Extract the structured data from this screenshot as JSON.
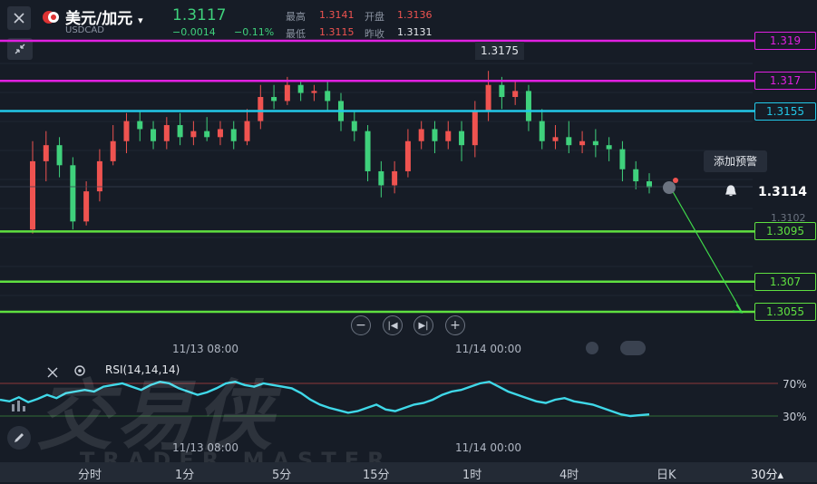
{
  "header": {
    "symbol": "美元/加元",
    "code": "USDCAD",
    "price": "1.3117",
    "change": "−0.0014",
    "change_pct": "−0.11%",
    "high_label": "最高",
    "high": "1.3141",
    "open_label": "开盘",
    "open": "1.3136",
    "low_label": "最低",
    "low": "1.3115",
    "prev_label": "昨收",
    "prev": "1.3131"
  },
  "colors": {
    "up": "#ef5350",
    "down": "#3fd17c",
    "magenta": "#e020e0",
    "cyan": "#22c8e8",
    "green": "#5fe040",
    "rsi": "#3fd8e8"
  },
  "levels": [
    {
      "label": "1.319",
      "value": 1.319,
      "color": "magenta"
    },
    {
      "label": "1.317",
      "value": 1.317,
      "color": "magenta"
    },
    {
      "label": "1.3155",
      "value": 1.3155,
      "color": "cyan"
    },
    {
      "label": "1.3095",
      "value": 1.3095,
      "color": "green"
    },
    {
      "label": "1.307",
      "value": 1.307,
      "color": "green"
    },
    {
      "label": "1.3055",
      "value": 1.3055,
      "color": "green"
    }
  ],
  "chart_data": {
    "type": "candlestick",
    "x": [
      "11/13 08:00",
      "11/14 00:00"
    ],
    "peak_label": "1.3175",
    "current_price": "1.3114",
    "axis_label": "1.3102",
    "add_alert": "添加预警",
    "candles": [
      [
        1.3096,
        1.313,
        1.314,
        1.3094
      ],
      [
        1.313,
        1.3138,
        1.3145,
        1.312
      ],
      [
        1.3138,
        1.3128,
        1.3142,
        1.3122
      ],
      [
        1.3128,
        1.31,
        1.3132,
        1.3096
      ],
      [
        1.31,
        1.3115,
        1.312,
        1.3098
      ],
      [
        1.3115,
        1.313,
        1.3136,
        1.311
      ],
      [
        1.313,
        1.314,
        1.3148,
        1.3128
      ],
      [
        1.314,
        1.315,
        1.3154,
        1.3134
      ],
      [
        1.315,
        1.3146,
        1.3155,
        1.314
      ],
      [
        1.3146,
        1.314,
        1.315,
        1.3136
      ],
      [
        1.314,
        1.3148,
        1.3152,
        1.3136
      ],
      [
        1.3148,
        1.3142,
        1.3154,
        1.3138
      ],
      [
        1.3142,
        1.3145,
        1.315,
        1.3138
      ],
      [
        1.3145,
        1.3142,
        1.3152,
        1.314
      ],
      [
        1.3142,
        1.3146,
        1.315,
        1.3138
      ],
      [
        1.3146,
        1.314,
        1.315,
        1.3136
      ],
      [
        1.314,
        1.315,
        1.3156,
        1.3138
      ],
      [
        1.315,
        1.3162,
        1.3168,
        1.3146
      ],
      [
        1.3162,
        1.316,
        1.3168,
        1.3156
      ],
      [
        1.316,
        1.3168,
        1.3172,
        1.3158
      ],
      [
        1.3168,
        1.3164,
        1.317,
        1.316
      ],
      [
        1.3164,
        1.3165,
        1.3168,
        1.316
      ],
      [
        1.3165,
        1.316,
        1.317,
        1.3155
      ],
      [
        1.316,
        1.315,
        1.3164,
        1.3145
      ],
      [
        1.315,
        1.3145,
        1.3155,
        1.314
      ],
      [
        1.3145,
        1.3125,
        1.3148,
        1.312
      ],
      [
        1.3125,
        1.3118,
        1.313,
        1.3112
      ],
      [
        1.3118,
        1.3125,
        1.313,
        1.3114
      ],
      [
        1.3125,
        1.314,
        1.3146,
        1.3122
      ],
      [
        1.314,
        1.3146,
        1.315,
        1.3136
      ],
      [
        1.3146,
        1.314,
        1.315,
        1.3134
      ],
      [
        1.314,
        1.3145,
        1.315,
        1.3136
      ],
      [
        1.3145,
        1.3138,
        1.315,
        1.313
      ],
      [
        1.3138,
        1.3155,
        1.316,
        1.3132
      ],
      [
        1.3155,
        1.3168,
        1.3175,
        1.315
      ],
      [
        1.3168,
        1.3162,
        1.3172,
        1.3156
      ],
      [
        1.3162,
        1.3165,
        1.317,
        1.3158
      ],
      [
        1.3165,
        1.315,
        1.3168,
        1.3145
      ],
      [
        1.315,
        1.314,
        1.3156,
        1.3136
      ],
      [
        1.314,
        1.3142,
        1.3148,
        1.3136
      ],
      [
        1.3142,
        1.3138,
        1.315,
        1.3134
      ],
      [
        1.3138,
        1.314,
        1.3145,
        1.3134
      ],
      [
        1.314,
        1.3138,
        1.3146,
        1.3132
      ],
      [
        1.3138,
        1.3136,
        1.3142,
        1.313
      ],
      [
        1.3136,
        1.3126,
        1.314,
        1.312
      ],
      [
        1.3126,
        1.312,
        1.313,
        1.3116
      ],
      [
        1.312,
        1.3117,
        1.3124,
        1.3114
      ]
    ],
    "rsi": {
      "label": "RSI(14,14,14)",
      "levels": [
        70,
        30
      ],
      "level_labels": [
        "70%",
        "30%"
      ],
      "values": [
        50,
        48,
        53,
        47,
        51,
        56,
        52,
        58,
        60,
        62,
        60,
        66,
        68,
        70,
        66,
        62,
        68,
        72,
        70,
        64,
        60,
        56,
        59,
        64,
        70,
        72,
        68,
        66,
        70,
        68,
        66,
        64,
        58,
        50,
        44,
        40,
        37,
        34,
        36,
        40,
        44,
        38,
        36,
        40,
        44,
        46,
        50,
        56,
        60,
        62,
        66,
        70,
        72,
        66,
        60,
        56,
        52,
        48,
        46,
        50,
        52,
        48,
        46,
        44,
        40,
        36,
        32,
        30,
        31,
        32
      ]
    }
  },
  "controls": {
    "time_a": "11/13 08:00",
    "time_b": "11/14 00:00"
  },
  "tabs": [
    "分时",
    "1分",
    "5分",
    "15分",
    "1时",
    "4时",
    "日K",
    "30分▴"
  ],
  "watermark": {
    "main": "交易侠",
    "sub": "TRADER MASTER"
  }
}
